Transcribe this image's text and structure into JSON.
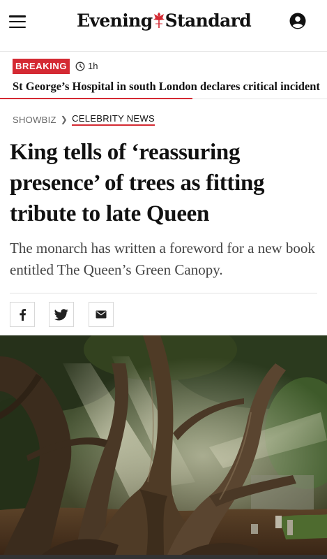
{
  "header": {
    "logo_text_left": "Evening",
    "logo_text_right": "Standard",
    "icons": {
      "menu": "hamburger-menu-icon",
      "account": "account-circle-icon"
    },
    "colors": {
      "logo_mark": "#d42a33"
    }
  },
  "breaking": {
    "badge": "BREAKING",
    "time": "1h",
    "headline": "St George’s Hospital in south London declares critical incident",
    "colors": {
      "accent": "#d42a33"
    }
  },
  "breadcrumb": {
    "section": "SHOWBIZ",
    "subsection": "CELEBRITY NEWS"
  },
  "article": {
    "headline": "King tells of ‘reassuring presence’ of trees as fitting tribute to late Queen",
    "standfirst": "The monarch has written a foreword for a new book entitled The Queen’s Green Canopy."
  },
  "share": {
    "icons": [
      "facebook-icon",
      "twitter-icon",
      "email-icon"
    ]
  },
  "hero_image": {
    "subject": "ancient-yew-trees-with-light-rays"
  }
}
